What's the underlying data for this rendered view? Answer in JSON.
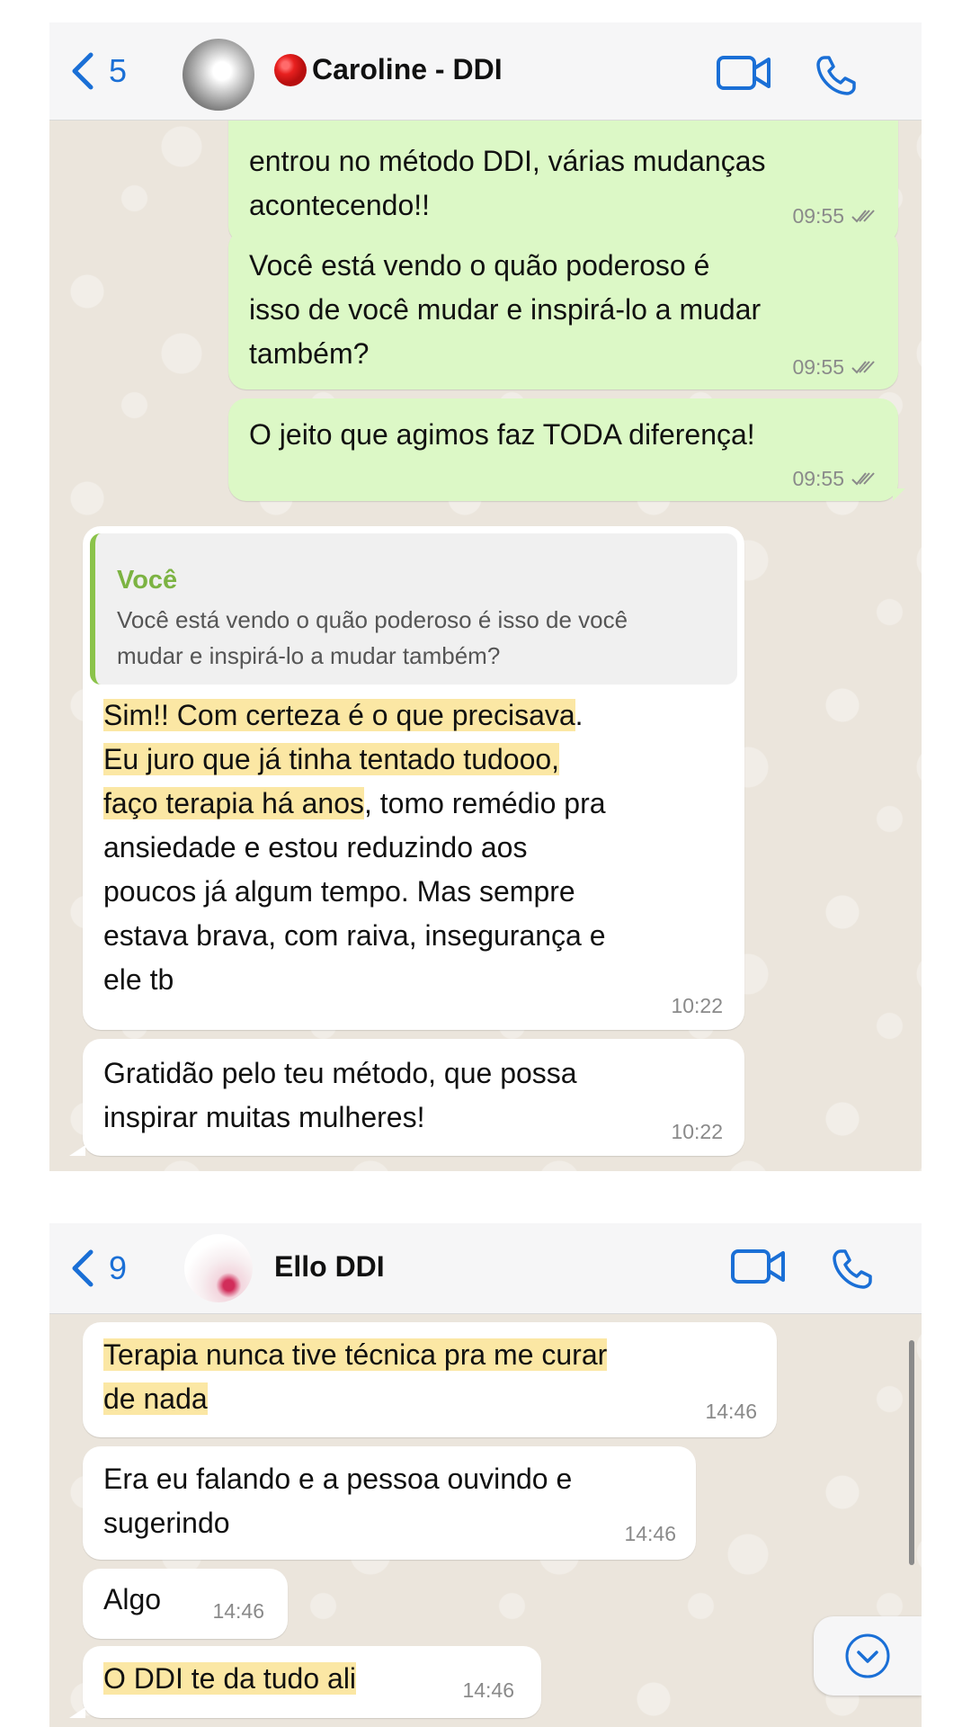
{
  "chat1": {
    "header": {
      "back_count": "5",
      "contact_name": "Caroline - DDI",
      "status_emoji": "red-circle"
    },
    "messages": [
      {
        "direction": "out",
        "lines": [
          "entrou no método DDI, várias mudanças",
          "acontecendo!!"
        ],
        "time": "09:55",
        "status": "read"
      },
      {
        "direction": "out",
        "lines": [
          "Você está vendo o quão poderoso é",
          "isso de você mudar e inspirá-lo a mudar",
          "também?"
        ],
        "time": "09:55",
        "status": "read"
      },
      {
        "direction": "out",
        "lines": [
          "O jeito que agimos faz TODA diferença!"
        ],
        "time": "09:55",
        "status": "read"
      },
      {
        "direction": "in",
        "reply_to": {
          "name": "Você",
          "lines": [
            "Você está vendo o quão poderoso é isso de você",
            "mudar e inspirá-lo a mudar também?"
          ]
        },
        "lines": [
          {
            "hl": "Sim!! Com certeza é o que precisava",
            "rest": "."
          },
          {
            "hl": "Eu juro que já tinha tentado tudooo,",
            "rest": ""
          },
          {
            "hl": "faço terapia há anos",
            "rest": ", tomo remédio pra"
          },
          {
            "hl": "",
            "rest": "ansiedade e estou reduzindo aos"
          },
          {
            "hl": "",
            "rest": "poucos já algum tempo. Mas sempre"
          },
          {
            "hl": "",
            "rest": "estava brava, com raiva, insegurança e"
          },
          {
            "hl": "",
            "rest": "ele tb"
          }
        ],
        "time": "10:22"
      },
      {
        "direction": "in",
        "lines": [
          "Gratidão pelo teu método, que possa",
          "inspirar muitas mulheres!"
        ],
        "time": "10:22"
      }
    ]
  },
  "chat2": {
    "header": {
      "back_count": "9",
      "contact_name": "Ello DDI"
    },
    "messages": [
      {
        "direction": "in",
        "highlighted": true,
        "lines": [
          "Terapia nunca tive técnica pra me curar",
          "de nada"
        ],
        "time": "14:46"
      },
      {
        "direction": "in",
        "highlighted": false,
        "lines": [
          "Era eu falando e a pessoa ouvindo e",
          "sugerindo"
        ],
        "time": "14:46"
      },
      {
        "direction": "in",
        "highlighted": false,
        "lines": [
          "Algo"
        ],
        "time": "14:46"
      },
      {
        "direction": "in",
        "highlighted": true,
        "lines": [
          "O DDI te da tudo ali"
        ],
        "time": "14:46"
      }
    ]
  },
  "colors": {
    "outgoing_bubble": "#dcf8c6",
    "incoming_bubble": "#ffffff",
    "highlight": "#fbe7a4",
    "accent_blue": "#1a6fd6",
    "quote_name": "#7cb342",
    "chat_background": "#ebe5dc"
  },
  "icons": [
    "chevron-left-icon",
    "video-camera-icon",
    "phone-icon",
    "double-check-icon",
    "chevron-down-circle-icon"
  ]
}
